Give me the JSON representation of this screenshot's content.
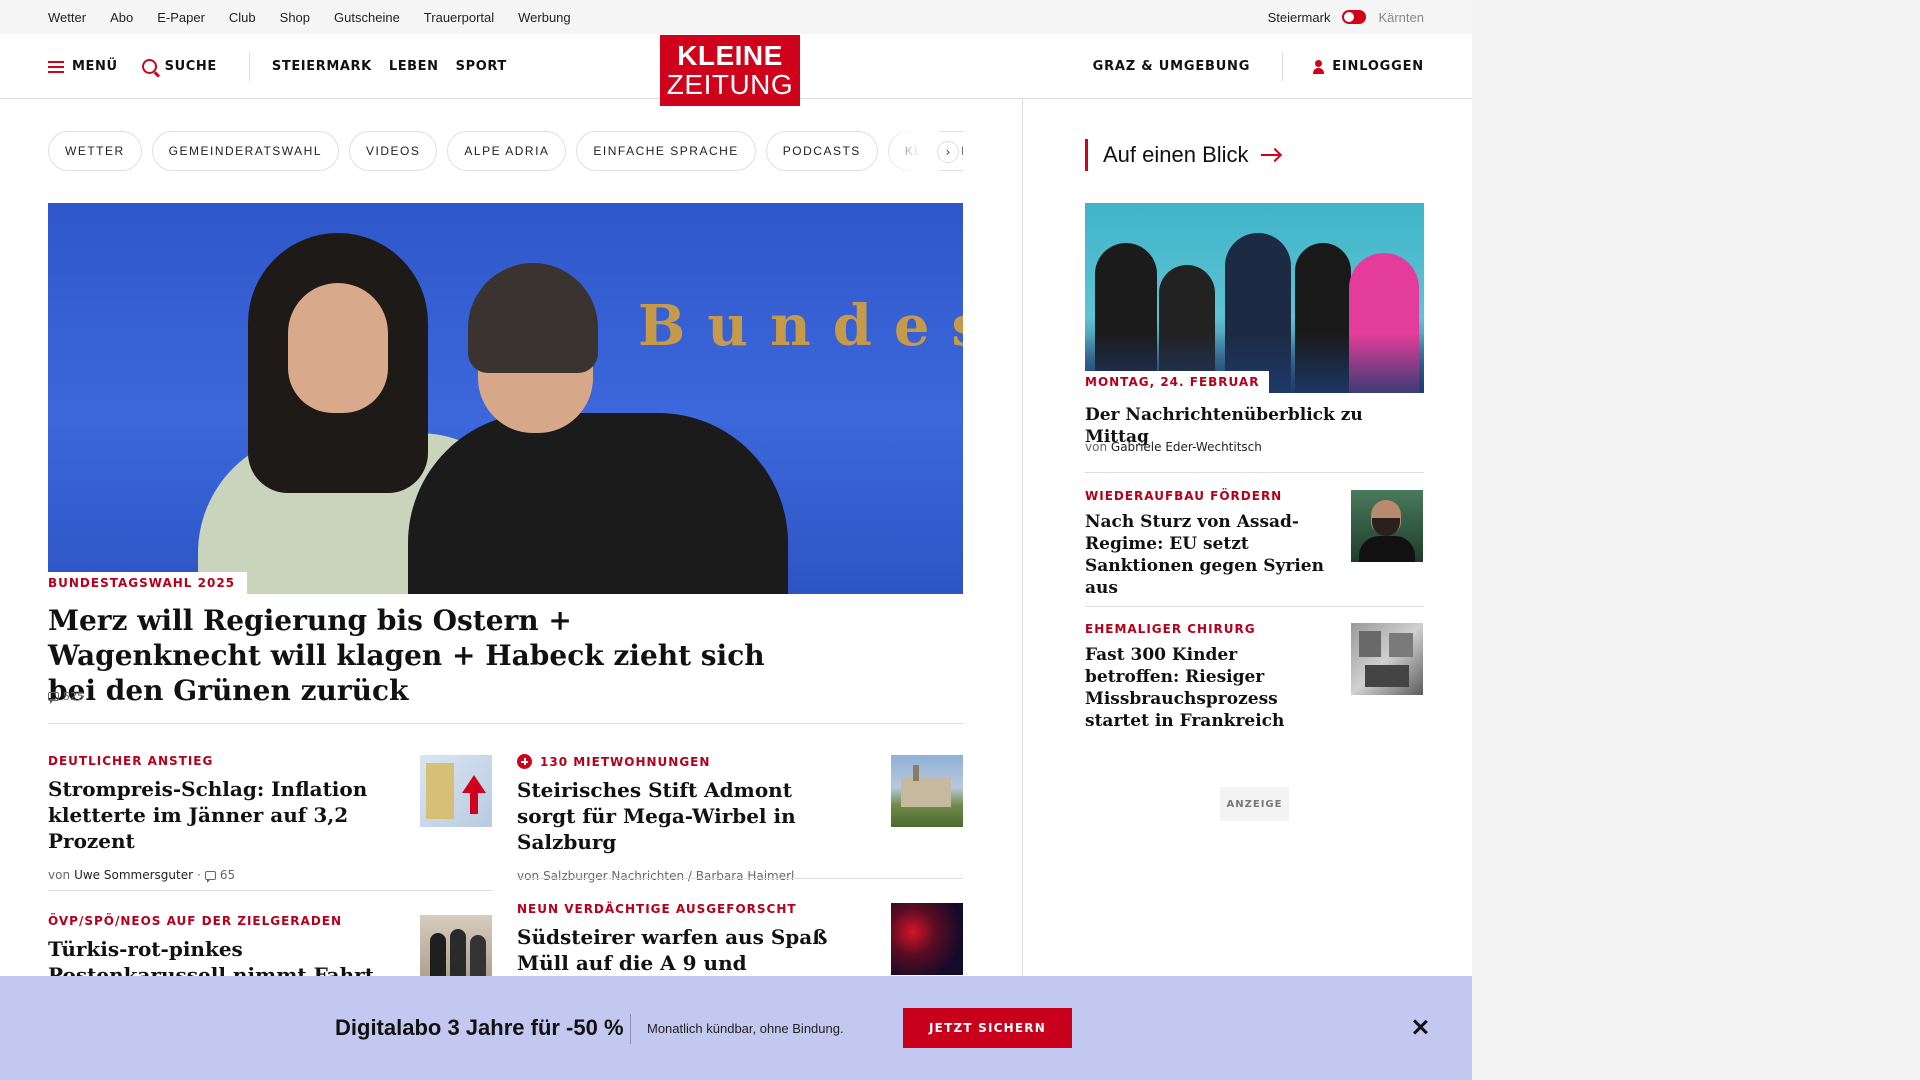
{
  "utility": {
    "links": [
      "Wetter",
      "Abo",
      "E-Paper",
      "Club",
      "Shop",
      "Gutscheine",
      "Trauerportal",
      "Werbung"
    ],
    "region_active": "Steiermark",
    "region_inactive": "Kärnten"
  },
  "header": {
    "menu_label": "MENÜ",
    "search_label": "SUCHE",
    "nav": [
      "STEIERMARK",
      "LEBEN",
      "SPORT"
    ],
    "logo_line1": "KLEINE",
    "logo_line2": "ZEITUNG",
    "local_label": "GRAZ & UMGEBUNG",
    "login_label": "EINLOGGEN"
  },
  "chips": [
    "WETTER",
    "GEMEINDERATSWAHL",
    "VIDEOS",
    "ALPE ADRIA",
    "EINFACHE SPRACHE",
    "PODCASTS",
    "KLEINE KINDERZEITUNG"
  ],
  "chips_arrow": "›",
  "hero": {
    "image_text": "Bundes",
    "kicker": "BUNDESTAGSWAHL 2025",
    "title": "Merz will Regierung bis Ostern + Wagenknecht will klagen + Habeck zieht sich bei den Grünen zurück",
    "comments": "525"
  },
  "articles": [
    {
      "kicker": "DEUTLICHER ANSTIEG",
      "title": "Strompreis-Schlag: Inflation kletterte im Jänner auf 3,2 Prozent",
      "by_prefix": "von",
      "author": "Uwe Sommersguter",
      "sep": "·",
      "comments": "65",
      "plus": false
    },
    {
      "kicker": "130 MIETWOHNUNGEN",
      "title": "Steirisches Stift Admont sorgt für Mega-Wirbel in Salzburg",
      "by_prefix": "von",
      "author": "Salzburger Nachrichten / Barbara Haimerl",
      "plus": true
    },
    {
      "kicker": "ÖVP/SPÖ/NEOS AUF DER ZIELGERADEN",
      "title": "Türkis-rot-pinkes Postenkarussell nimmt Fahrt auf",
      "plus": false
    },
    {
      "kicker": "NEUN VERDÄCHTIGE AUSGEFORSCHT",
      "title": "Südsteirer warfen aus Spaß Müll auf die A 9 und",
      "plus": false
    }
  ],
  "sidebar": {
    "title": "Auf einen Blick",
    "top": {
      "date": "MONTAG, 24. FEBRUAR",
      "title": "Der Nachrichtenüberblick zu Mittag",
      "by_prefix": "von",
      "author": "Gabriele Eder-Wechtitsch"
    },
    "items": [
      {
        "kicker": "WIEDERAUFBAU FÖRDERN",
        "title": "Nach Sturz von Assad-Regime: EU setzt Sanktionen gegen Syrien aus"
      },
      {
        "kicker": "EHEMALIGER CHIRURG",
        "title": "Fast 300 Kinder betroffen: Riesiger Missbrauchsprozess startet in Frankreich"
      }
    ],
    "ad_label": "ANZEIGE"
  },
  "banner": {
    "title": "Digitalabo 3 Jahre für -50 %",
    "subtitle": "Monatlich kündbar, ohne Bindung.",
    "cta": "JETZT SICHERN"
  },
  "colors": {
    "brand_red": "#d0021b",
    "kicker_red": "#b5001b",
    "banner_bg": "#c3c8f0"
  }
}
